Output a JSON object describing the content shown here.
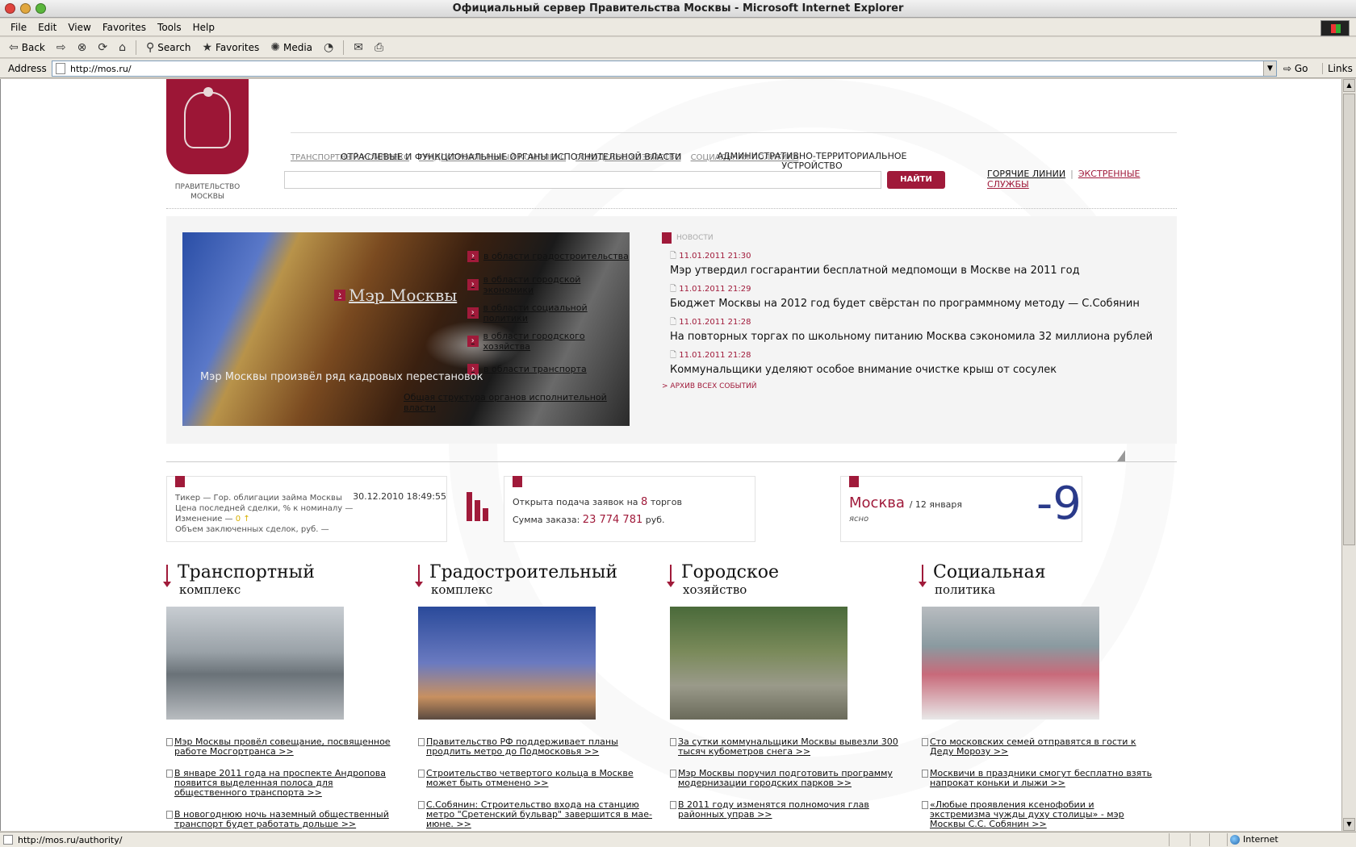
{
  "window": {
    "title": "Официальный сервер Правительства Москвы - Microsoft Internet Explorer"
  },
  "menu": [
    "File",
    "Edit",
    "View",
    "Favorites",
    "Tools",
    "Help"
  ],
  "toolbar": {
    "back": "Back",
    "search": "Search",
    "favorites": "Favorites",
    "media": "Media"
  },
  "address": {
    "label": "Address",
    "url": "http://mos.ru/",
    "go": "Go",
    "links": "Links"
  },
  "status": {
    "text": "http://mos.ru/authority/",
    "zone": "Internet"
  },
  "header": {
    "org": "ПРАВИТЕЛЬСТВО МОСКВЫ",
    "nav_main": [
      "ОТРАСЛЕВЫЕ И ФУНКЦИОНАЛЬНЫЕ ОРГАНЫ ИСПОЛНИТЕЛЬНОЙ ВЛАСТИ",
      "АДМИНИСТРАТИВНО-ТЕРРИТОРИАЛЬНОЕ УСТРОЙСТВО"
    ],
    "nav_sub": [
      "ТРАНСПОРТНЫЙ КОМПЛЕКС",
      "ГРАДОСТРОИТЕЛЬНЫЙ КОМПЛЕКС",
      "ГОРОДСКОЕ ХОЗЯЙСТВО",
      "СОЦИАЛЬНАЯ ПОЛИТИКА"
    ],
    "search_button": "НАЙТИ",
    "hotlines": "ГОРЯЧИЕ ЛИНИИ",
    "emergency": "ЭКСТРЕННЫЕ СЛУЖБЫ"
  },
  "hero": {
    "title": "Мэр Москвы",
    "links": [
      "в области градостроительства",
      "в области городской экономики",
      "в области социальной политики",
      "в области городского хозяйства",
      "в области транспорта"
    ],
    "caption": "Мэр Москвы произвёл ряд кадровых перестановок",
    "structure": "Общая структура органов исполнительной власти"
  },
  "news": {
    "label": "Новости",
    "items": [
      {
        "date": "11.01.2011 21:30",
        "title": "Мэр утвердил госгарантии бесплатной медпомощи в Москве на 2011 год"
      },
      {
        "date": "11.01.2011 21:29",
        "title": "Бюджет Москвы на 2012 год будет свёрстан по программному методу — С.Собянин"
      },
      {
        "date": "11.01.2011 21:28",
        "title": "На повторных торгах по школьному питанию Москва сэкономила 32 миллиона рублей"
      },
      {
        "date": "11.01.2011 21:28",
        "title": "Коммунальщики уделяют особое внимание очистке крыш от сосулек"
      }
    ],
    "archive": "АРХИВ ВСЕХ СОБЫТИЙ"
  },
  "bond": {
    "ticker": "Тикер — Гор. облигации займа Москвы",
    "price": "Цена последней сделки, % к номиналу —",
    "change_label": "Изменение —",
    "change_value": "0",
    "volume": "Объем заключенных сделок, руб. —",
    "datetime": "30.12.2010 18:49:55"
  },
  "tender": {
    "open_prefix": "Открыта подача заявок на",
    "count": "8",
    "open_suffix": "торгов",
    "sum_label": "Сумма заказа:",
    "sum": "23 774 781",
    "sum_unit": "руб."
  },
  "weather": {
    "city": "Москва",
    "date": "/ 12 января",
    "condition": "ясно",
    "temp": "-9"
  },
  "sections": [
    {
      "t1": "Транспортный",
      "t2": "комплекс",
      "links": [
        "Мэр Москвы провёл совещание, посвященное работе Мосгортранса >>",
        "В январе 2011 года на проспекте Андропова появится выделенная полоса для общественного транспорта >>",
        "В новогоднюю ночь наземный общественный транспорт будет работать дольше >>"
      ]
    },
    {
      "t1": "Градостроительный",
      "t2": "комплекс",
      "links": [
        "Правительство РФ поддерживает планы продлить метро до Подмосковья >>",
        "Строительство четвертого кольца в Москве может быть отменено >>",
        "С.Собянин: Строительство входа на станцию метро \"Сретенский бульвар\" завершится в мае-июне. >>"
      ]
    },
    {
      "t1": "Городское",
      "t2": "хозяйство",
      "links": [
        "За сутки коммунальщики Москвы вывезли 300 тысяч кубометров снега >>",
        "Мэр Москвы поручил подготовить программу модернизации городских парков >>",
        "В 2011 году изменятся полномочия глав районных управ >>"
      ]
    },
    {
      "t1": "Социальная",
      "t2": "политика",
      "links": [
        "Сто московских семей отправятся в гости к Деду Морозу >>",
        "Москвичи в праздники смогут бесплатно взять напрокат коньки и лыжи >>",
        "«Любые проявления ксенофобии и экстремизма чужды духу столицы» - мэр Москвы С.С. Собянин >>"
      ]
    }
  ]
}
